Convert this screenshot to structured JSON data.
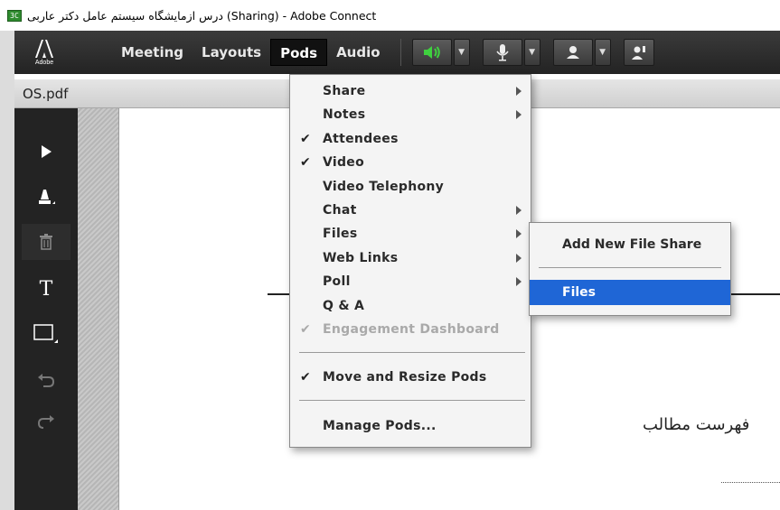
{
  "window": {
    "title": "درس ازمایشگاه سیستم عامل دکتر عاربی (Sharing) - Adobe Connect",
    "app_icon_text": "3C"
  },
  "menubar": {
    "logo_text": "Adobe",
    "items": [
      "Meeting",
      "Layouts",
      "Pods",
      "Audio"
    ],
    "active_item": "Pods",
    "speaker_color": "#3fd13f"
  },
  "pod": {
    "title": "OS.pdf"
  },
  "whiteboard_tools": [
    {
      "icon": "pointer-icon"
    },
    {
      "icon": "highlighter-icon"
    },
    {
      "icon": "trash-icon"
    },
    {
      "icon": "text-tool-icon",
      "text": "T"
    },
    {
      "icon": "rectangle-icon"
    },
    {
      "icon": "undo-icon"
    },
    {
      "icon": "redo-icon"
    }
  ],
  "pods_menu": {
    "items": [
      {
        "label": "Share",
        "checked": false,
        "submenu": true,
        "disabled": false
      },
      {
        "label": "Notes",
        "checked": false,
        "submenu": true,
        "disabled": false
      },
      {
        "label": "Attendees",
        "checked": true,
        "submenu": false,
        "disabled": false
      },
      {
        "label": "Video",
        "checked": true,
        "submenu": false,
        "disabled": false
      },
      {
        "label": "Video Telephony",
        "checked": false,
        "submenu": false,
        "disabled": false
      },
      {
        "label": "Chat",
        "checked": false,
        "submenu": true,
        "disabled": false
      },
      {
        "label": "Files",
        "checked": false,
        "submenu": true,
        "disabled": false
      },
      {
        "label": "Web Links",
        "checked": false,
        "submenu": true,
        "disabled": false
      },
      {
        "label": "Poll",
        "checked": false,
        "submenu": true,
        "disabled": false
      },
      {
        "label": "Q & A",
        "checked": false,
        "submenu": false,
        "disabled": false
      },
      {
        "label": "Engagement Dashboard",
        "checked": true,
        "submenu": false,
        "disabled": true
      }
    ],
    "move_resize": {
      "label": "Move and Resize Pods",
      "checked": true
    },
    "manage": {
      "label": "Manage Pods..."
    }
  },
  "files_submenu": {
    "items": [
      {
        "label": "Add New File Share",
        "highlighted": false
      },
      {
        "label": "Files",
        "highlighted": true
      }
    ],
    "highlight_color": "#1f66d6"
  },
  "document": {
    "toc_heading": "فهرست مطالب"
  }
}
